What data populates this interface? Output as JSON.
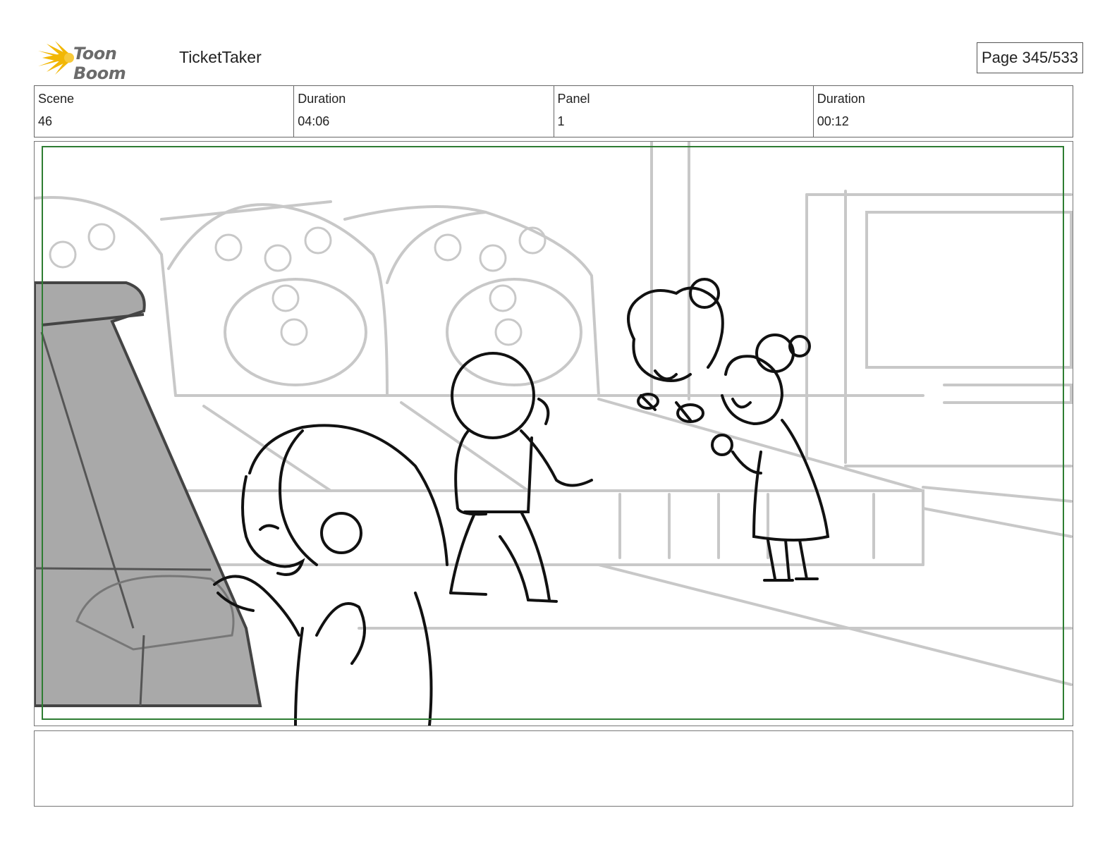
{
  "header": {
    "logo_text": "Toon Boom",
    "project_title": "TicketTaker",
    "page_label": "Page 345/533"
  },
  "info": {
    "scene_label": "Scene",
    "scene_value": "46",
    "scene_duration_label": "Duration",
    "scene_duration_value": "04:06",
    "panel_label": "Panel",
    "panel_value": "1",
    "panel_duration_label": "Duration",
    "panel_duration_value": "00:12"
  },
  "notes": {
    "text": ""
  },
  "colors": {
    "safe_frame": "#2e7d32",
    "logo_star": "#f2b705",
    "sketch_background": "#c8c8c8",
    "sketch_foreground": "#111111",
    "machine_fill": "#a9a9a9"
  }
}
